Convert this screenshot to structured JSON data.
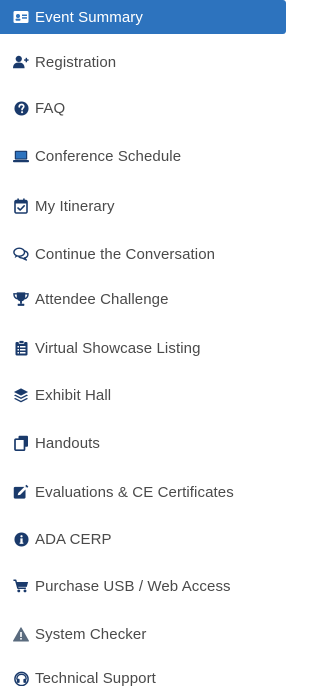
{
  "colors": {
    "accent": "#2d73be",
    "icon": "#1a3a6b",
    "text": "#4a4a4a",
    "active_text": "#ffffff"
  },
  "menu": {
    "items": [
      {
        "label": "Event Summary",
        "icon": "id-card-icon",
        "active": true
      },
      {
        "label": "Registration",
        "icon": "user-plus-icon"
      },
      {
        "label": "FAQ",
        "icon": "question-circle-icon"
      },
      {
        "label": "Conference Schedule",
        "icon": "laptop-icon"
      },
      {
        "label": "My Itinerary",
        "icon": "calendar-check-icon"
      },
      {
        "label": "Continue the Conversation",
        "icon": "comments-icon"
      },
      {
        "label": "Attendee Challenge",
        "icon": "trophy-icon"
      },
      {
        "label": "Virtual Showcase Listing",
        "icon": "clipboard-list-icon"
      },
      {
        "label": "Exhibit Hall",
        "icon": "layer-group-icon"
      },
      {
        "label": "Handouts",
        "icon": "copy-icon"
      },
      {
        "label": "Evaluations & CE Certificates",
        "icon": "edit-icon"
      },
      {
        "label": "ADA CERP",
        "icon": "info-circle-icon"
      },
      {
        "label": "Purchase USB / Web Access",
        "icon": "shopping-cart-icon"
      },
      {
        "label": "System Checker",
        "icon": "warning-icon"
      },
      {
        "label": "Technical Support",
        "icon": "headset-icon"
      }
    ]
  }
}
